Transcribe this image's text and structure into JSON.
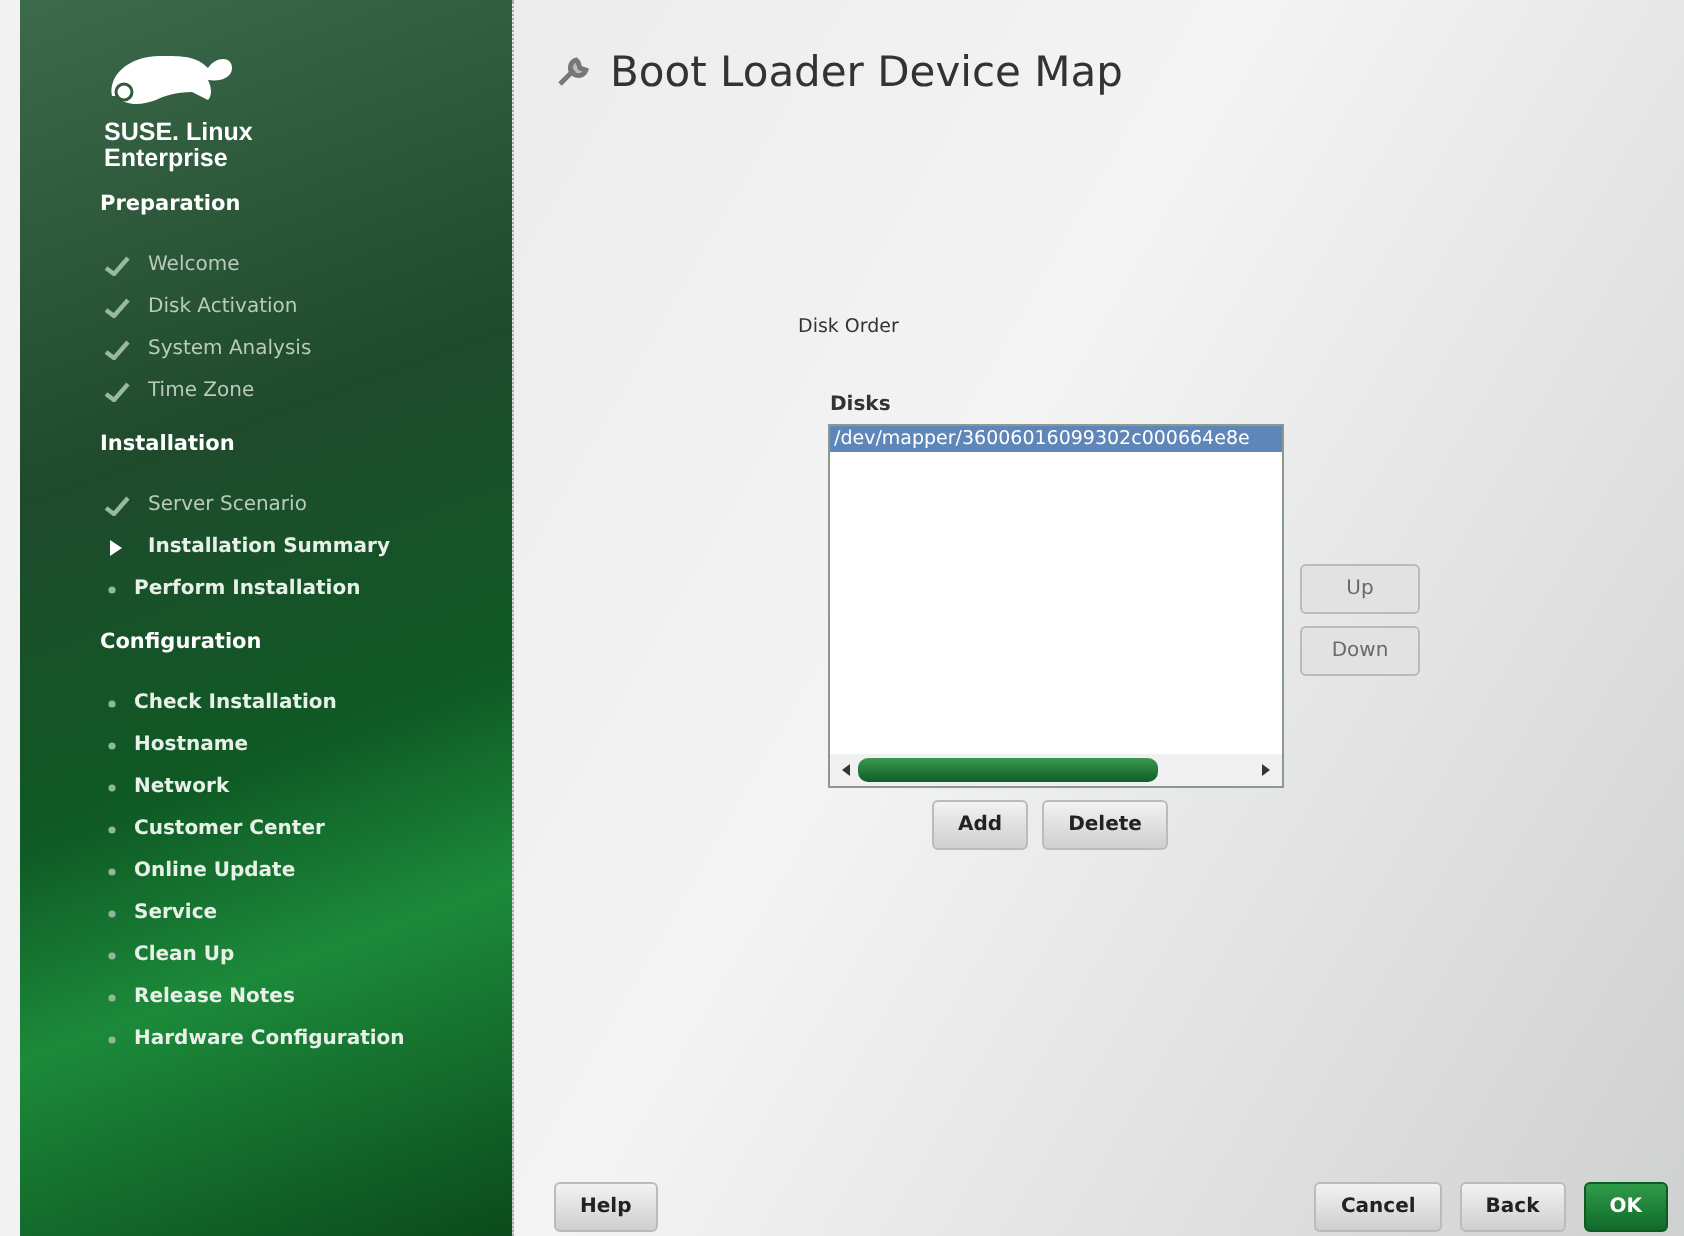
{
  "brand": {
    "line_1": "SUSE. Linux",
    "line_2": "Enterprise"
  },
  "sidebar": {
    "sections": [
      {
        "title": "Preparation",
        "items": [
          {
            "label": "Welcome",
            "kind": "done"
          },
          {
            "label": "Disk Activation",
            "kind": "done"
          },
          {
            "label": "System Analysis",
            "kind": "done"
          },
          {
            "label": "Time Zone",
            "kind": "done"
          }
        ]
      },
      {
        "title": "Installation",
        "items": [
          {
            "label": "Server Scenario",
            "kind": "done"
          },
          {
            "label": "Installation Summary",
            "kind": "current"
          },
          {
            "label": "Perform Installation",
            "kind": "pending"
          }
        ]
      },
      {
        "title": "Configuration",
        "items": [
          {
            "label": "Check Installation",
            "kind": "pending"
          },
          {
            "label": "Hostname",
            "kind": "pending"
          },
          {
            "label": "Network",
            "kind": "pending"
          },
          {
            "label": "Customer Center",
            "kind": "pending"
          },
          {
            "label": "Online Update",
            "kind": "pending"
          },
          {
            "label": "Service",
            "kind": "pending"
          },
          {
            "label": "Clean Up",
            "kind": "pending"
          },
          {
            "label": "Release Notes",
            "kind": "pending"
          },
          {
            "label": "Hardware Configuration",
            "kind": "pending"
          }
        ]
      }
    ]
  },
  "page": {
    "title": "Boot Loader Device Map",
    "group_label": "Disk Order",
    "list_label": "Disks",
    "disks": [
      {
        "label": "/dev/mapper/36006016099302c000664e8e",
        "selected": true
      }
    ],
    "side_buttons": [
      {
        "label": "Up",
        "disabled": true
      },
      {
        "label": "Down",
        "disabled": true
      }
    ],
    "list_buttons": [
      {
        "label": "Add",
        "disabled": false
      },
      {
        "label": "Delete",
        "disabled": false
      }
    ]
  },
  "footer": {
    "help": "Help",
    "buttons": [
      {
        "label": "Cancel",
        "primary": false
      },
      {
        "label": "Back",
        "primary": false
      },
      {
        "label": "OK",
        "primary": true
      }
    ]
  }
}
